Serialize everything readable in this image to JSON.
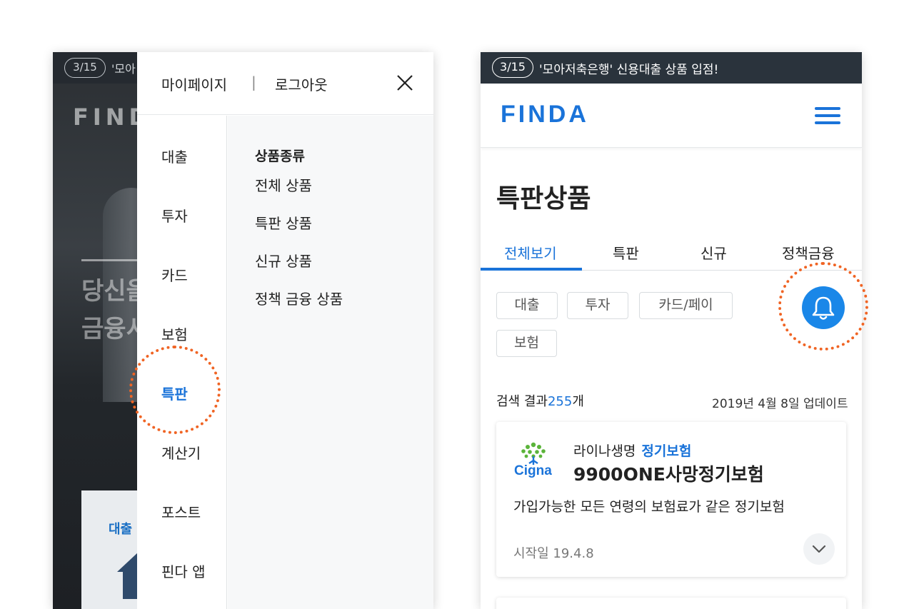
{
  "colors": {
    "accent": "#1a73d9",
    "highlight_ring": "#f06424",
    "banner_bg": "#2a333c",
    "bell_bg": "#1a87e8"
  },
  "left_screen": {
    "background": {
      "banner_counter": "3/15",
      "banner_text": "'모아",
      "logo_text": "FIND",
      "headline_line1": "당신을",
      "headline_line2": "금융서",
      "card_label": "대출"
    },
    "menu": {
      "mypage_label": "마이페이지",
      "separator": "|",
      "logout_label": "로그아웃",
      "close_icon": "close-icon",
      "categories": [
        {
          "label": "대출"
        },
        {
          "label": "투자"
        },
        {
          "label": "카드"
        },
        {
          "label": "보험"
        },
        {
          "label": "특판",
          "active": true
        },
        {
          "label": "계산기"
        },
        {
          "label": "포스트"
        },
        {
          "label": "핀다 앱"
        }
      ],
      "submenu_heading": "상품종류",
      "submenu_items": [
        {
          "label": "전체 상품"
        },
        {
          "label": "특판 상품"
        },
        {
          "label": "신규 상품"
        },
        {
          "label": "정책 금융 상품"
        }
      ]
    }
  },
  "right_screen": {
    "banner": {
      "counter": "3/15",
      "text": "'모아저축은행' 신용대출 상품 입점!"
    },
    "header": {
      "logo": "FINDA",
      "menu_icon": "hamburger-icon"
    },
    "page_title": "특판상품",
    "tabs": [
      {
        "label": "전체보기",
        "active": true
      },
      {
        "label": "특판"
      },
      {
        "label": "신규"
      },
      {
        "label": "정책금융"
      }
    ],
    "filter_chips": [
      {
        "label": "대출"
      },
      {
        "label": "투자"
      },
      {
        "label": "카드/페이"
      },
      {
        "label": "보험"
      }
    ],
    "bell_icon": "bell-icon",
    "results": {
      "prefix": "검색 결과",
      "count": "255",
      "suffix": "개",
      "updated": "2019년 4월 8일 업데이트"
    },
    "product_card": {
      "brand_logo_text": "Cigna",
      "company": "라이나생명",
      "category": "정기보험",
      "product_name": "9900ONE사망정기보험",
      "description": "가입가능한 모든 연령의 보험료가 같은 정기보험",
      "start_date": "시작일 19.4.8",
      "expand_icon": "chevron-down-icon"
    }
  }
}
